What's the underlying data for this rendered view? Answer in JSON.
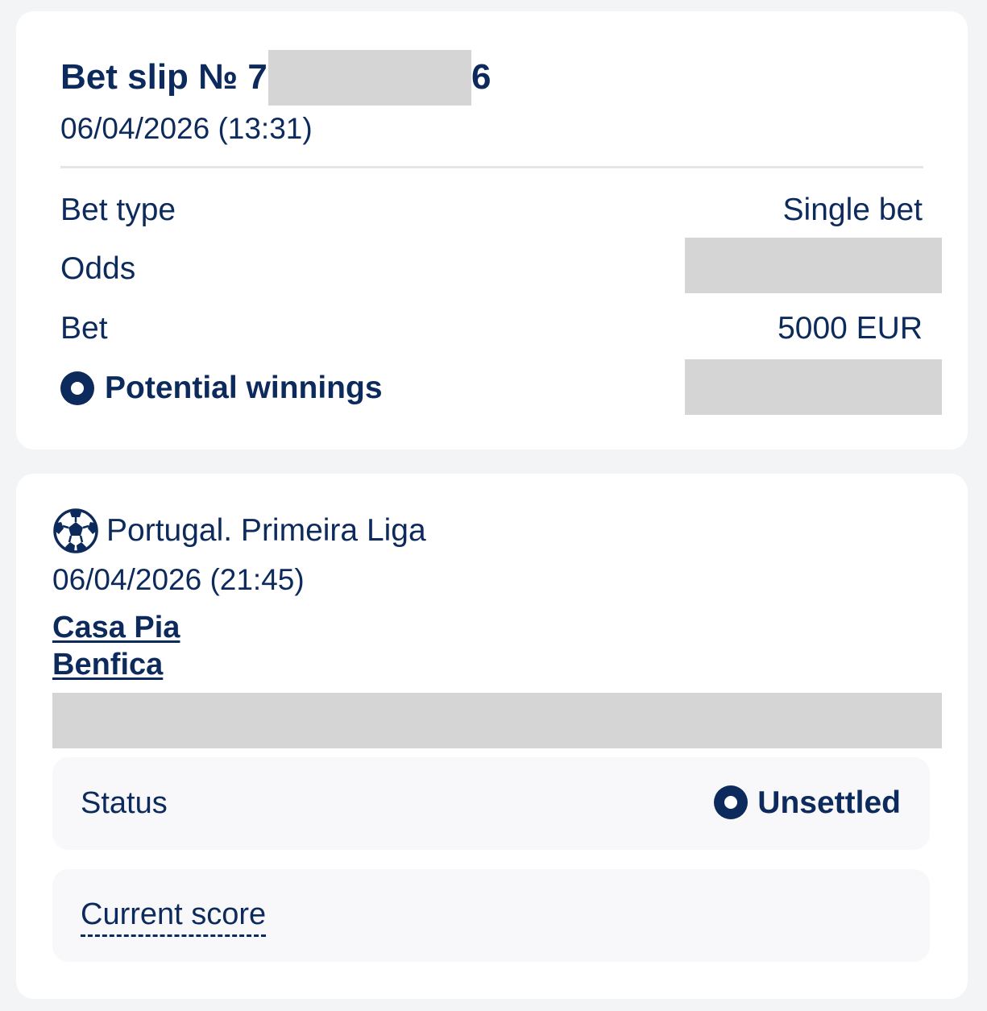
{
  "summary": {
    "title_prefix": "Bet slip № 7",
    "title_suffix": "6",
    "created": "06/04/2026 (13:31)",
    "rows": {
      "bet_type_label": "Bet type",
      "bet_type_value": "Single bet",
      "odds_label": "Odds",
      "bet_label": "Bet",
      "bet_value": "5000 EUR",
      "winnings_label": "Potential winnings"
    }
  },
  "event": {
    "league": "Portugal. Primeira Liga",
    "date": "06/04/2026 (21:45)",
    "team_home": "Casa Pia",
    "team_away": "Benfica",
    "status_label": "Status",
    "status_value": "Unsettled",
    "score_label": "Current score"
  },
  "colors": {
    "text": "#0d2a5c",
    "redaction": "#d5d5d5",
    "page_bg": "#f3f4f6"
  },
  "icons": [
    "status-dot-icon",
    "soccer-ball-icon"
  ]
}
